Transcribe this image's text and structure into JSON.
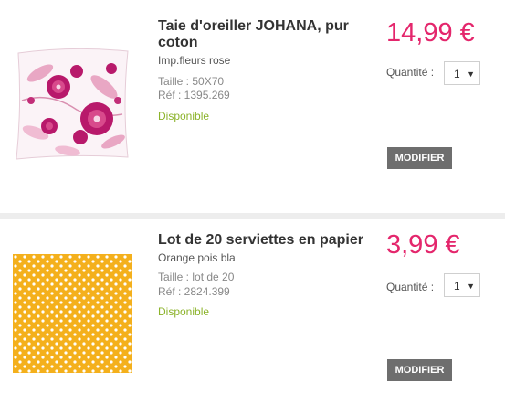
{
  "items": [
    {
      "title": "Taie d'oreiller JOHANA, pur coton",
      "variant": "Imp.fleurs rose",
      "size": "Taille : 50X70",
      "ref": "Réf : 1395.269",
      "availability": "Disponible",
      "price": "14,99 €",
      "quantity_label": "Quantité :",
      "quantity": "1",
      "modify_label": "MODIFIER",
      "image": "floral-pillow"
    },
    {
      "title": "Lot de 20 serviettes en papier",
      "variant": "Orange pois bla",
      "size": "Taille : lot de 20",
      "ref": "Réf : 2824.399",
      "availability": "Disponible",
      "price": "3,99 €",
      "quantity_label": "Quantité :",
      "quantity": "1",
      "modify_label": "MODIFIER",
      "image": "orange-polka-dot-napkin"
    }
  ],
  "colors": {
    "price": "#e4266c",
    "availability": "#8cb32b",
    "button": "#6e6e6e",
    "napkin": "#f4b01c"
  }
}
